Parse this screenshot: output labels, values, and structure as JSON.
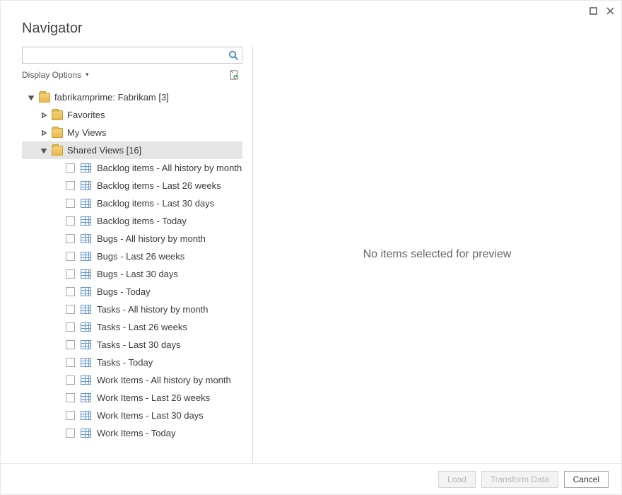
{
  "window": {
    "title": "Navigator"
  },
  "search": {
    "placeholder": ""
  },
  "optionsLabel": "Display Options",
  "tree": {
    "root": {
      "label": "fabrikamprime: Fabrikam [3]"
    },
    "favorites": {
      "label": "Favorites"
    },
    "myViews": {
      "label": "My Views"
    },
    "shared": {
      "label": "Shared Views [16]"
    },
    "items": [
      {
        "label": "Backlog items - All history by month"
      },
      {
        "label": "Backlog items - Last 26 weeks"
      },
      {
        "label": "Backlog items - Last 30 days"
      },
      {
        "label": "Backlog items - Today"
      },
      {
        "label": "Bugs - All history by month"
      },
      {
        "label": "Bugs - Last 26 weeks"
      },
      {
        "label": "Bugs - Last 30 days"
      },
      {
        "label": "Bugs - Today"
      },
      {
        "label": "Tasks - All history by month"
      },
      {
        "label": "Tasks - Last 26 weeks"
      },
      {
        "label": "Tasks - Last 30 days"
      },
      {
        "label": "Tasks - Today"
      },
      {
        "label": "Work Items - All history by month"
      },
      {
        "label": "Work Items - Last 26 weeks"
      },
      {
        "label": "Work Items - Last 30 days"
      },
      {
        "label": "Work Items - Today"
      }
    ]
  },
  "preview": {
    "emptyMsg": "No items selected for preview"
  },
  "footer": {
    "load": "Load",
    "transform": "Transform Data",
    "cancel": "Cancel"
  }
}
